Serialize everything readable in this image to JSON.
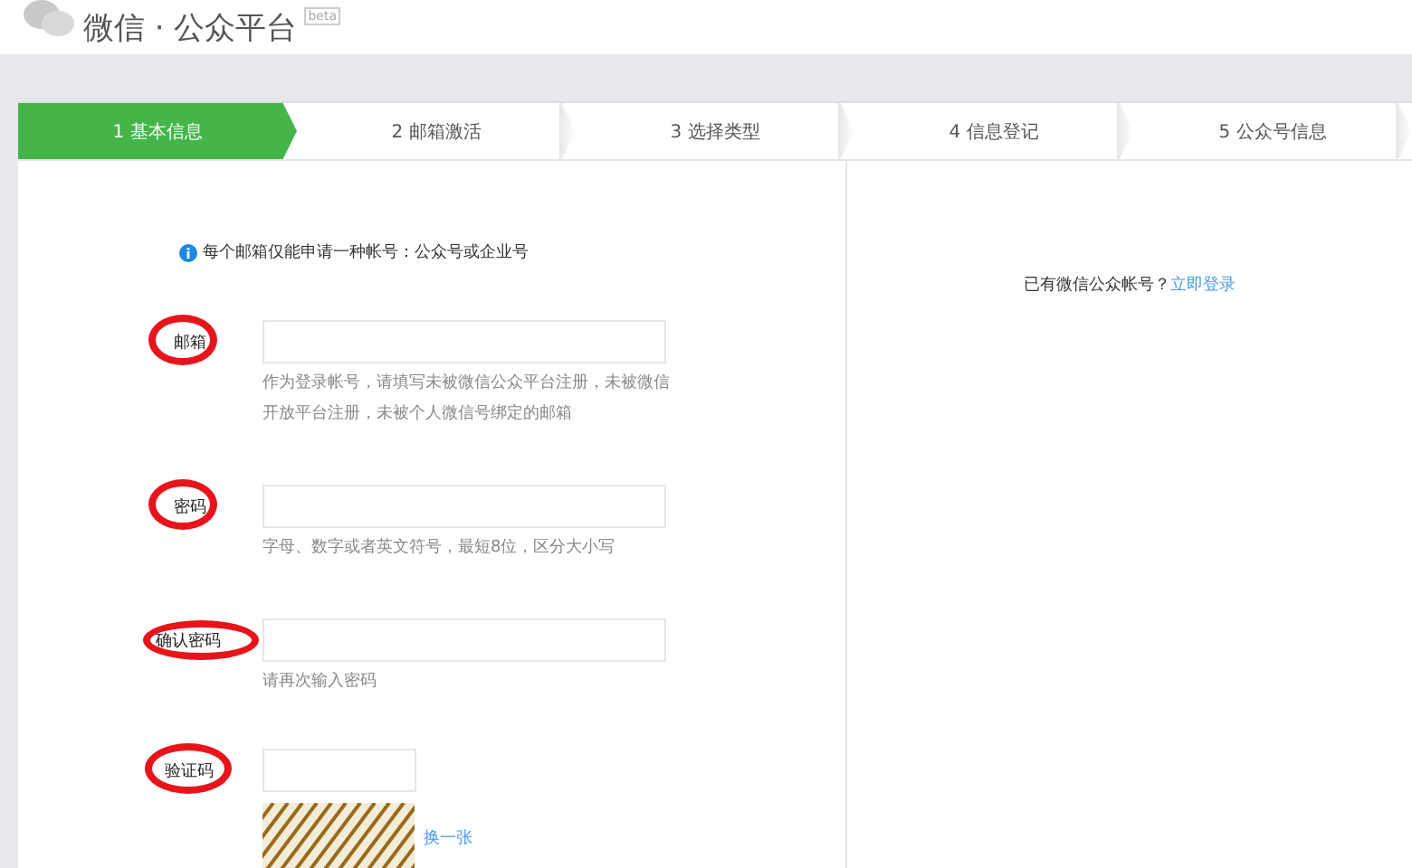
{
  "header": {
    "title": "微信 · 公众平台",
    "badge": "beta"
  },
  "steps": [
    {
      "label": "1 基本信息",
      "selected": true
    },
    {
      "label": "2 邮箱激活",
      "selected": false
    },
    {
      "label": "3 选择类型",
      "selected": false
    },
    {
      "label": "4 信息登记",
      "selected": false
    },
    {
      "label": "5 公众号信息",
      "selected": false
    }
  ],
  "notice": "每个邮箱仅能申请一种帐号：公众号或企业号",
  "fields": [
    {
      "kind": "text",
      "label": "邮箱",
      "circled": true,
      "hint": "作为登录帐号，请填写未被微信公众平台注册，未被微信开放平台注册，未被个人微信号绑定的邮箱"
    },
    {
      "kind": "text",
      "label": "密码",
      "circled": true,
      "hint": "字母、数字或者英文符号，最短8位，区分大小写"
    },
    {
      "kind": "text",
      "label": "确认密码",
      "circled": true,
      "hint": "请再次输入密码"
    },
    {
      "kind": "captcha",
      "label": "验证码",
      "circled": true,
      "refresh_link": "换一张"
    }
  ],
  "side": {
    "text": "已有微信公众帐号？",
    "link": "立即登录"
  }
}
